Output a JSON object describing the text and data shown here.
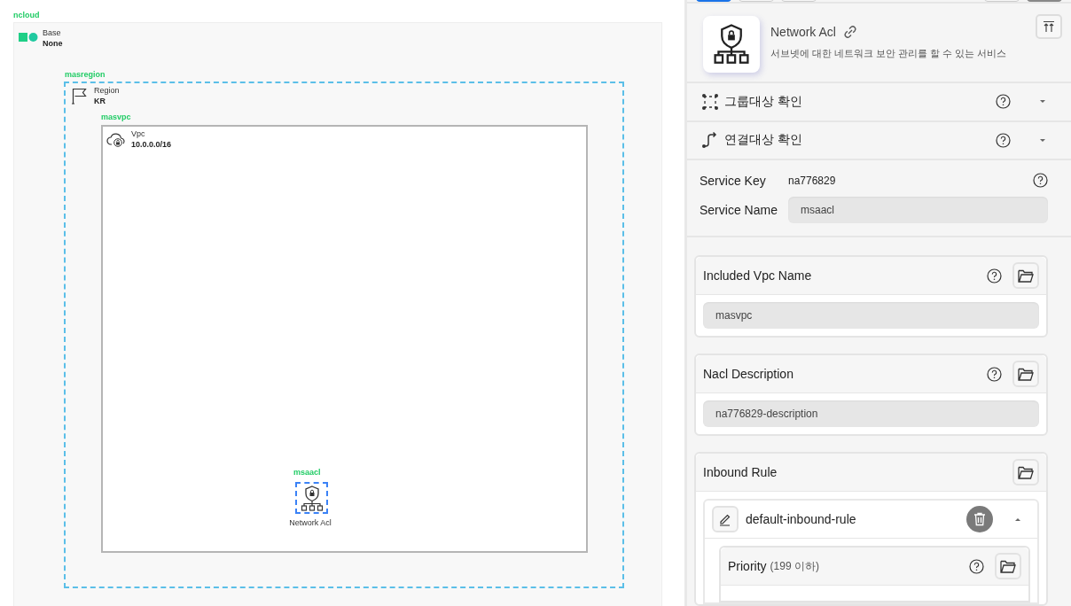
{
  "diagram": {
    "root": {
      "label": "ncloud",
      "title": "Base",
      "value": "None"
    },
    "region": {
      "label": "masregion",
      "title": "Region",
      "value": "KR"
    },
    "vpc": {
      "label": "masvpc",
      "title": "Vpc",
      "value": "10.0.0.0/16"
    },
    "node": {
      "label": "msaacl",
      "caption": "Network Acl",
      "selected": true
    }
  },
  "panel": {
    "title": "Network Acl",
    "description": "서브넷에 대한 네트워크 보안 관리를 할 수 있는 서비스",
    "sections": [
      {
        "kind": "group",
        "label": "그룹대상 확인",
        "expanded": false
      },
      {
        "kind": "link",
        "label": "연결대상 확인",
        "expanded": false
      }
    ],
    "service_key": {
      "label": "Service Key",
      "value": "na776829"
    },
    "service_name": {
      "label": "Service Name",
      "value": "msaacl"
    },
    "fields": [
      {
        "label": "Included Vpc Name",
        "value": "masvpc"
      },
      {
        "label": "Nacl Description",
        "value": "na776829-description"
      }
    ],
    "inbound": {
      "label": "Inbound Rule",
      "rules": [
        {
          "name": "default-inbound-rule",
          "expanded": true,
          "fields": [
            {
              "label": "Priority",
              "hint": "(199 이하)"
            }
          ]
        }
      ]
    }
  }
}
